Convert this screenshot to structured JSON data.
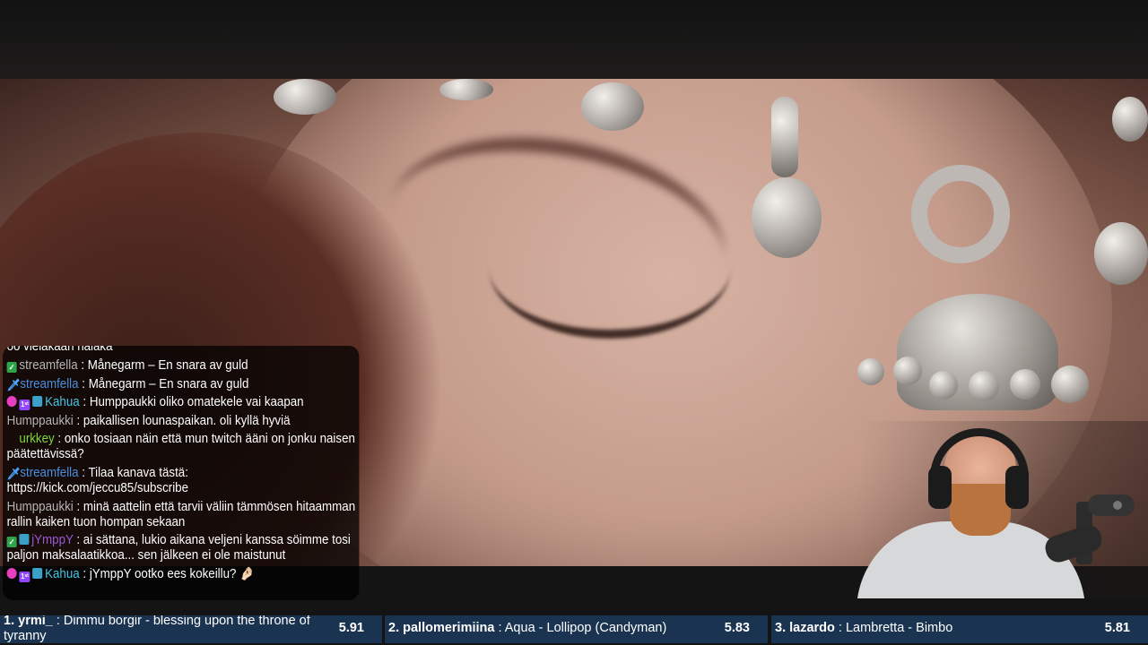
{
  "chat": {
    "messages": [
      {
        "badges": [],
        "user": "",
        "user_color": "#ffffff",
        "text": "oo vieläkään näläkä"
      },
      {
        "badges": [
          "check"
        ],
        "user": "streamfella",
        "user_color": "#b5b5b5",
        "text": "Månegarm – En snara av guld"
      },
      {
        "badges": [
          "sword"
        ],
        "user": "streamfella",
        "user_color": "#4a8fe0",
        "text": "Månegarm – En snara av guld"
      },
      {
        "badges": [
          "heart",
          "sub-1",
          "mod"
        ],
        "user": "Kahua",
        "user_color": "#3fc7e6",
        "text": "Humppaukki oliko omatekele vai kaapan"
      },
      {
        "badges": [],
        "user": "Humppaukki",
        "user_color": "#b5b5b5",
        "text": "paikallisen lounaspaikan. oli kyllä hyviä"
      },
      {
        "badges": [
          "blank"
        ],
        "user": "urkkey",
        "user_color": "#7cd83a",
        "text": "onko tosiaan näin että mun twitch ääni on jonku naisen päätettävissä?"
      },
      {
        "badges": [
          "sword"
        ],
        "user": "streamfella",
        "user_color": "#4a8fe0",
        "text": "Tilaa kanava tästä: https://kick.com/jeccu85/subscribe"
      },
      {
        "badges": [],
        "user": "Humppaukki",
        "user_color": "#b5b5b5",
        "text": "minä aattelin että tarvii väliin tämmösen hitaamman rallin kaiken tuon hompan sekaan"
      },
      {
        "badges": [
          "check",
          "mod"
        ],
        "user": "jYmppY",
        "user_color": "#9b59d6",
        "text": "ai sättana, lukio aikana veljeni kanssa söimme tosi paljon maksalaatikkoa... sen jälkeen ei ole maistunut"
      },
      {
        "badges": [
          "heart",
          "sub-1",
          "mod"
        ],
        "user": "Kahua",
        "user_color": "#3fc7e6",
        "text": "jYmppY ootko ees kokeillu? 🤌🏻"
      }
    ]
  },
  "leaderboard": [
    {
      "rank": "1.",
      "user": "yrmi_",
      "song": "Dimmu borgir - blessing upon the throne of tyranny",
      "score": "5.91"
    },
    {
      "rank": "2.",
      "user": "pallomerimiina",
      "song": "Aqua - Lollipop (Candyman)",
      "score": "5.83"
    },
    {
      "rank": "3.",
      "user": "lazardo",
      "song": "Lambretta - Bimbo",
      "score": "5.81"
    }
  ],
  "colors": {
    "leaderboard_bg": "#1a3350",
    "chat_bg": "rgba(0,0,0,0.72)"
  }
}
